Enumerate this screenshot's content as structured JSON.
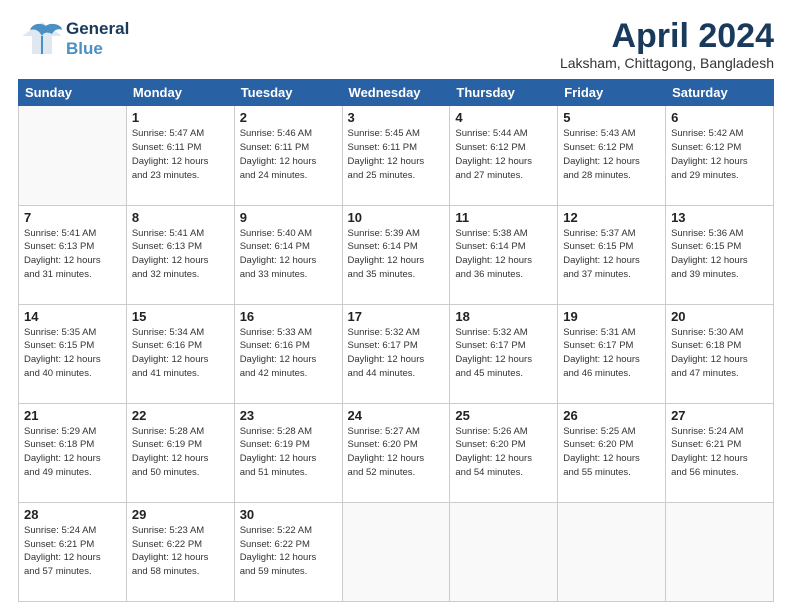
{
  "header": {
    "logo_general": "General",
    "logo_blue": "Blue",
    "month": "April 2024",
    "location": "Laksham, Chittagong, Bangladesh"
  },
  "weekdays": [
    "Sunday",
    "Monday",
    "Tuesday",
    "Wednesday",
    "Thursday",
    "Friday",
    "Saturday"
  ],
  "weeks": [
    [
      {
        "day": "",
        "info": ""
      },
      {
        "day": "1",
        "info": "Sunrise: 5:47 AM\nSunset: 6:11 PM\nDaylight: 12 hours\nand 23 minutes."
      },
      {
        "day": "2",
        "info": "Sunrise: 5:46 AM\nSunset: 6:11 PM\nDaylight: 12 hours\nand 24 minutes."
      },
      {
        "day": "3",
        "info": "Sunrise: 5:45 AM\nSunset: 6:11 PM\nDaylight: 12 hours\nand 25 minutes."
      },
      {
        "day": "4",
        "info": "Sunrise: 5:44 AM\nSunset: 6:12 PM\nDaylight: 12 hours\nand 27 minutes."
      },
      {
        "day": "5",
        "info": "Sunrise: 5:43 AM\nSunset: 6:12 PM\nDaylight: 12 hours\nand 28 minutes."
      },
      {
        "day": "6",
        "info": "Sunrise: 5:42 AM\nSunset: 6:12 PM\nDaylight: 12 hours\nand 29 minutes."
      }
    ],
    [
      {
        "day": "7",
        "info": "Sunrise: 5:41 AM\nSunset: 6:13 PM\nDaylight: 12 hours\nand 31 minutes."
      },
      {
        "day": "8",
        "info": "Sunrise: 5:41 AM\nSunset: 6:13 PM\nDaylight: 12 hours\nand 32 minutes."
      },
      {
        "day": "9",
        "info": "Sunrise: 5:40 AM\nSunset: 6:14 PM\nDaylight: 12 hours\nand 33 minutes."
      },
      {
        "day": "10",
        "info": "Sunrise: 5:39 AM\nSunset: 6:14 PM\nDaylight: 12 hours\nand 35 minutes."
      },
      {
        "day": "11",
        "info": "Sunrise: 5:38 AM\nSunset: 6:14 PM\nDaylight: 12 hours\nand 36 minutes."
      },
      {
        "day": "12",
        "info": "Sunrise: 5:37 AM\nSunset: 6:15 PM\nDaylight: 12 hours\nand 37 minutes."
      },
      {
        "day": "13",
        "info": "Sunrise: 5:36 AM\nSunset: 6:15 PM\nDaylight: 12 hours\nand 39 minutes."
      }
    ],
    [
      {
        "day": "14",
        "info": "Sunrise: 5:35 AM\nSunset: 6:15 PM\nDaylight: 12 hours\nand 40 minutes."
      },
      {
        "day": "15",
        "info": "Sunrise: 5:34 AM\nSunset: 6:16 PM\nDaylight: 12 hours\nand 41 minutes."
      },
      {
        "day": "16",
        "info": "Sunrise: 5:33 AM\nSunset: 6:16 PM\nDaylight: 12 hours\nand 42 minutes."
      },
      {
        "day": "17",
        "info": "Sunrise: 5:32 AM\nSunset: 6:17 PM\nDaylight: 12 hours\nand 44 minutes."
      },
      {
        "day": "18",
        "info": "Sunrise: 5:32 AM\nSunset: 6:17 PM\nDaylight: 12 hours\nand 45 minutes."
      },
      {
        "day": "19",
        "info": "Sunrise: 5:31 AM\nSunset: 6:17 PM\nDaylight: 12 hours\nand 46 minutes."
      },
      {
        "day": "20",
        "info": "Sunrise: 5:30 AM\nSunset: 6:18 PM\nDaylight: 12 hours\nand 47 minutes."
      }
    ],
    [
      {
        "day": "21",
        "info": "Sunrise: 5:29 AM\nSunset: 6:18 PM\nDaylight: 12 hours\nand 49 minutes."
      },
      {
        "day": "22",
        "info": "Sunrise: 5:28 AM\nSunset: 6:19 PM\nDaylight: 12 hours\nand 50 minutes."
      },
      {
        "day": "23",
        "info": "Sunrise: 5:28 AM\nSunset: 6:19 PM\nDaylight: 12 hours\nand 51 minutes."
      },
      {
        "day": "24",
        "info": "Sunrise: 5:27 AM\nSunset: 6:20 PM\nDaylight: 12 hours\nand 52 minutes."
      },
      {
        "day": "25",
        "info": "Sunrise: 5:26 AM\nSunset: 6:20 PM\nDaylight: 12 hours\nand 54 minutes."
      },
      {
        "day": "26",
        "info": "Sunrise: 5:25 AM\nSunset: 6:20 PM\nDaylight: 12 hours\nand 55 minutes."
      },
      {
        "day": "27",
        "info": "Sunrise: 5:24 AM\nSunset: 6:21 PM\nDaylight: 12 hours\nand 56 minutes."
      }
    ],
    [
      {
        "day": "28",
        "info": "Sunrise: 5:24 AM\nSunset: 6:21 PM\nDaylight: 12 hours\nand 57 minutes."
      },
      {
        "day": "29",
        "info": "Sunrise: 5:23 AM\nSunset: 6:22 PM\nDaylight: 12 hours\nand 58 minutes."
      },
      {
        "day": "30",
        "info": "Sunrise: 5:22 AM\nSunset: 6:22 PM\nDaylight: 12 hours\nand 59 minutes."
      },
      {
        "day": "",
        "info": ""
      },
      {
        "day": "",
        "info": ""
      },
      {
        "day": "",
        "info": ""
      },
      {
        "day": "",
        "info": ""
      }
    ]
  ]
}
